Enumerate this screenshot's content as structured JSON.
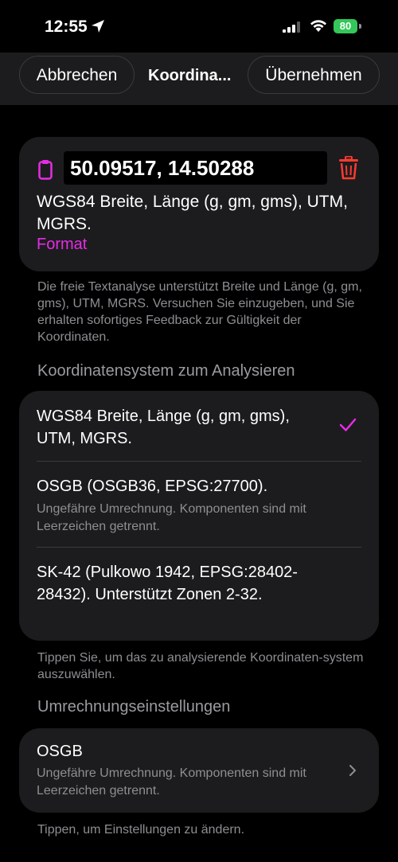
{
  "status": {
    "time": "12:55",
    "battery": "80"
  },
  "nav": {
    "cancel_label": "Abbrechen",
    "title": "Koordina...",
    "apply_label": "Übernehmen"
  },
  "input": {
    "value": "50.09517, 14.50288",
    "format_desc": "WGS84 Breite, Länge (g, gm, gms), UTM, MGRS.",
    "format_link": "Format"
  },
  "help_text": "Die freie Textanalyse unterstützt Breite und Länge (g, gm, gms), UTM, MGRS. Versuchen Sie einzugeben, und Sie erhalten sofortiges Feedback zur Gültigkeit der Koordinaten.",
  "parse_section": {
    "header": "Koordinatensystem zum Analysieren",
    "options": [
      {
        "title": "WGS84 Breite, Länge (g, gm, gms), UTM, MGRS.",
        "subtitle": "",
        "selected": true
      },
      {
        "title": "OSGB (OSGB36, EPSG:27700).",
        "subtitle": "Ungefähre Umrechnung. Komponenten sind mit Leerzeichen getrennt.",
        "selected": false
      },
      {
        "title": "SK-42 (Pulkowo 1942, EPSG:28402-28432). Unterstützt Zonen 2-32.",
        "subtitle": "",
        "selected": false
      }
    ],
    "footer": "Tippen Sie, um das zu analysierende Koordinaten-system auszuwählen."
  },
  "conversion_section": {
    "header": "Umrechnungseinstellungen",
    "item": {
      "title": "OSGB",
      "subtitle": "Ungefähre Umrechnung. Komponenten sind mit Leerzeichen getrennt."
    },
    "footer": "Tippen, um Einstellungen zu ändern."
  },
  "colors": {
    "accent": "#e62ce6",
    "trash": "#ff3b30",
    "battery": "#34c759"
  },
  "icons": [
    "location-arrow-icon",
    "signal-icon",
    "wifi-icon",
    "battery-icon",
    "clipboard-icon",
    "trash-icon",
    "checkmark-icon",
    "chevron-right-icon"
  ]
}
